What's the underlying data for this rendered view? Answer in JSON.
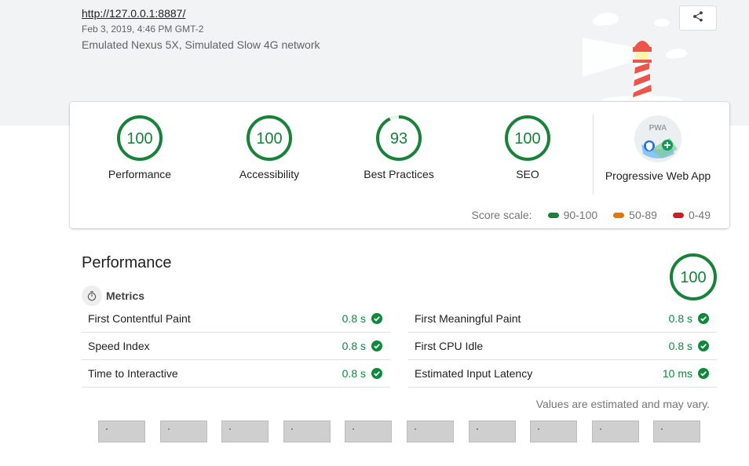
{
  "header": {
    "url": "http://127.0.0.1:8887/",
    "timestamp": "Feb 3, 2019, 4:46 PM GMT-2",
    "environment": "Emulated Nexus 5X, Simulated Slow 4G network",
    "share_icon": "share-icon",
    "logo_icon": "lighthouse-icon"
  },
  "scores": [
    {
      "label": "Performance",
      "value": "100",
      "fraction": 1.0
    },
    {
      "label": "Accessibility",
      "value": "100",
      "fraction": 1.0
    },
    {
      "label": "Best Practices",
      "value": "93",
      "fraction": 0.93
    },
    {
      "label": "SEO",
      "value": "100",
      "fraction": 1.0
    }
  ],
  "pwa": {
    "label": "Progressive Web App",
    "badge_text": "PWA"
  },
  "score_scale": {
    "label": "Score scale:",
    "ranges": [
      {
        "label": "90-100",
        "color": "#0cce6b"
      },
      {
        "label": "50-89",
        "color": "#ffa400"
      },
      {
        "label": "0-49",
        "color": "#ff4e42"
      }
    ]
  },
  "performance": {
    "title": "Performance",
    "score": "100",
    "metrics_title": "Metrics",
    "metrics_left": [
      {
        "name": "First Contentful Paint",
        "value": "0.8 s"
      },
      {
        "name": "Speed Index",
        "value": "0.8 s"
      },
      {
        "name": "Time to Interactive",
        "value": "0.8 s"
      }
    ],
    "metrics_right": [
      {
        "name": "First Meaningful Paint",
        "value": "0.8 s"
      },
      {
        "name": "First CPU Idle",
        "value": "0.8 s"
      },
      {
        "name": "Estimated Input Latency",
        "value": "10 ms"
      }
    ],
    "estimated_note": "Values are estimated and may vary."
  },
  "colors": {
    "pass": "#0b8a3b",
    "gauge_stroke": "#178239"
  }
}
